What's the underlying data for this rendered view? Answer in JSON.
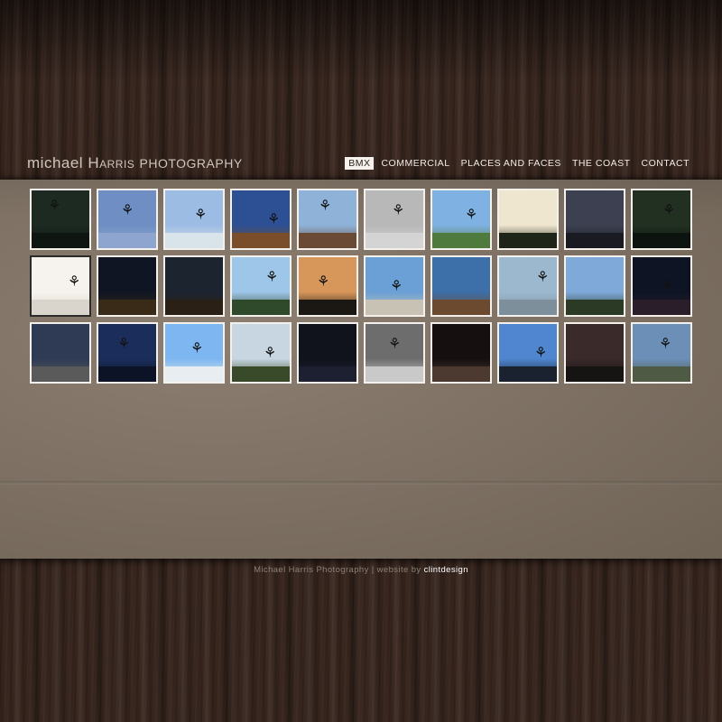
{
  "site": {
    "logo_part1": "michael",
    "logo_part2": "Harris",
    "logo_part3": "PHOTOGRAPHY"
  },
  "nav": {
    "items": [
      {
        "label": "BMX",
        "active": true
      },
      {
        "label": "COMMERCIAL",
        "active": false
      },
      {
        "label": "PLACES AND FACES",
        "active": false
      },
      {
        "label": "THE COAST",
        "active": false
      },
      {
        "label": "CONTACT",
        "active": false
      }
    ]
  },
  "gallery": {
    "rows": 3,
    "cols": 10,
    "thumbs": [
      {
        "sky": "#1d2a22",
        "ground": "#0f1612",
        "rider": true
      },
      {
        "sky": "#6f8fc4",
        "ground": "#8ea6cf",
        "rider": true
      },
      {
        "sky": "#9dbce3",
        "ground": "#d8e3ea",
        "rider": true
      },
      {
        "sky": "#2d4f94",
        "ground": "#7a4e2a",
        "rider": true
      },
      {
        "sky": "#8fb2d8",
        "ground": "#6a4a35",
        "rider": true
      },
      {
        "sky": "#b8b8b8",
        "ground": "#d4d4d4",
        "rider": true
      },
      {
        "sky": "#7fb2e2",
        "ground": "#4f7a3e",
        "rider": true
      },
      {
        "sky": "#efe6cf",
        "ground": "#1f2418",
        "rider": false
      },
      {
        "sky": "#3c4050",
        "ground": "#1a1b22",
        "rider": false
      },
      {
        "sky": "#223022",
        "ground": "#0d140f",
        "rider": true
      },
      {
        "sky": "#f6f3ee",
        "ground": "#d9d4cc",
        "rider": true
      },
      {
        "sky": "#0f1522",
        "ground": "#3a2a18",
        "rider": false
      },
      {
        "sky": "#1c2430",
        "ground": "#2a2015",
        "rider": false
      },
      {
        "sky": "#9ec6e8",
        "ground": "#2f4a2a",
        "rider": true
      },
      {
        "sky": "#d7975a",
        "ground": "#1b1712",
        "rider": true
      },
      {
        "sky": "#6aa0d6",
        "ground": "#c8c2b4",
        "rider": true
      },
      {
        "sky": "#3d6fa8",
        "ground": "#6b4a2f",
        "rider": false
      },
      {
        "sky": "#9cb8cf",
        "ground": "#7d8f9a",
        "rider": true
      },
      {
        "sky": "#7fa9d9",
        "ground": "#2a3a24",
        "rider": false
      },
      {
        "sky": "#0e1424",
        "ground": "#2a1e2a",
        "rider": true
      },
      {
        "sky": "#2f3a55",
        "ground": "#5a5a5a",
        "rider": false
      },
      {
        "sky": "#1b2d5a",
        "ground": "#0d1326",
        "rider": true
      },
      {
        "sky": "#7db6f0",
        "ground": "#e8edf2",
        "rider": true
      },
      {
        "sky": "#c7d6e1",
        "ground": "#394a2a",
        "rider": true
      },
      {
        "sky": "#10131c",
        "ground": "#1c2030",
        "rider": false
      },
      {
        "sky": "#6d6d6d",
        "ground": "#c9c9c9",
        "rider": true
      },
      {
        "sky": "#160f10",
        "ground": "#4c3a30",
        "rider": true
      },
      {
        "sky": "#4f86cf",
        "ground": "#1a2230",
        "rider": true
      },
      {
        "sky": "#3a2a2a",
        "ground": "#161313",
        "rider": false
      },
      {
        "sky": "#6c8fb8",
        "ground": "#4e5a44",
        "rider": true
      }
    ]
  },
  "footer": {
    "text": "Michael Harris Photography | website by",
    "credit": "clintdesign"
  },
  "colors": {
    "wood": "#2f2019",
    "panel": "#7d7063",
    "thumb_border": "#f4f1ec",
    "nav_active_bg": "#f5f2ee"
  }
}
